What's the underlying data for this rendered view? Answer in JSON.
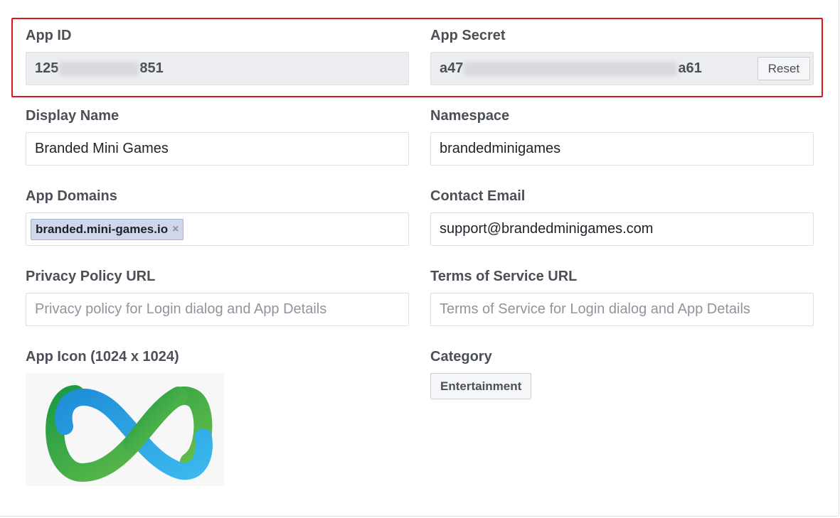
{
  "app_id": {
    "label": "App ID",
    "prefix": "125",
    "suffix": "851"
  },
  "app_secret": {
    "label": "App Secret",
    "prefix": "a47",
    "suffix": "a61",
    "reset_label": "Reset"
  },
  "display_name": {
    "label": "Display Name",
    "value": "Branded Mini Games"
  },
  "namespace": {
    "label": "Namespace",
    "value": "brandedminigames"
  },
  "app_domains": {
    "label": "App Domains",
    "tokens": [
      "branded.mini-games.io"
    ],
    "remove_glyph": "×"
  },
  "contact_email": {
    "label": "Contact Email",
    "value": "support@brandedminigames.com"
  },
  "privacy_policy": {
    "label": "Privacy Policy URL",
    "placeholder": "Privacy policy for Login dialog and App Details"
  },
  "terms_of_service": {
    "label": "Terms of Service URL",
    "placeholder": "Terms of Service for Login dialog and App Details"
  },
  "app_icon": {
    "label": "App Icon (1024 x 1024)",
    "icon": "infinity-logo-icon"
  },
  "category": {
    "label": "Category",
    "value": "Entertainment"
  },
  "colors": {
    "highlight": "#e0141e",
    "logo_blue": "#2aa7e3",
    "logo_green": "#2fa84a"
  }
}
